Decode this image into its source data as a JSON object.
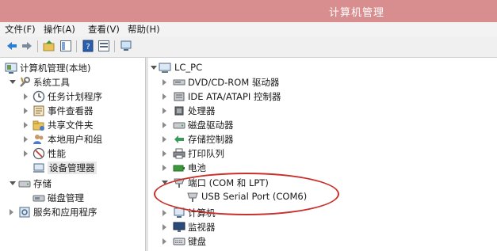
{
  "window": {
    "title": "计算机管理"
  },
  "menu": {
    "file": "文件(F)",
    "action": "操作(A)",
    "view": "查看(V)",
    "help": "帮助(H)"
  },
  "toolbar": {
    "icons": [
      "back-arrow",
      "forward-arrow",
      "folder-up",
      "show-hide-tree",
      "help-book",
      "properties"
    ]
  },
  "left_tree": {
    "root": "计算机管理(本地)",
    "system_tools": "系统工具",
    "task_scheduler": "任务计划程序",
    "event_viewer": "事件查看器",
    "shared_folders": "共享文件夹",
    "local_users": "本地用户和组",
    "performance": "性能",
    "device_manager": "设备管理器",
    "storage": "存储",
    "disk_management": "磁盘管理",
    "services_apps": "服务和应用程序"
  },
  "right_tree": {
    "root": "LC_PC",
    "items": [
      "DVD/CD-ROM 驱动器",
      "IDE ATA/ATAPI 控制器",
      "处理器",
      "磁盘驱动器",
      "存储控制器",
      "打印队列",
      "电池",
      "端口 (COM 和 LPT)",
      "USB Serial Port (COM6)",
      "计算机",
      "监视器",
      "键盘"
    ],
    "selected_left": "设备管理器",
    "highlight_color": "#c9302c"
  }
}
